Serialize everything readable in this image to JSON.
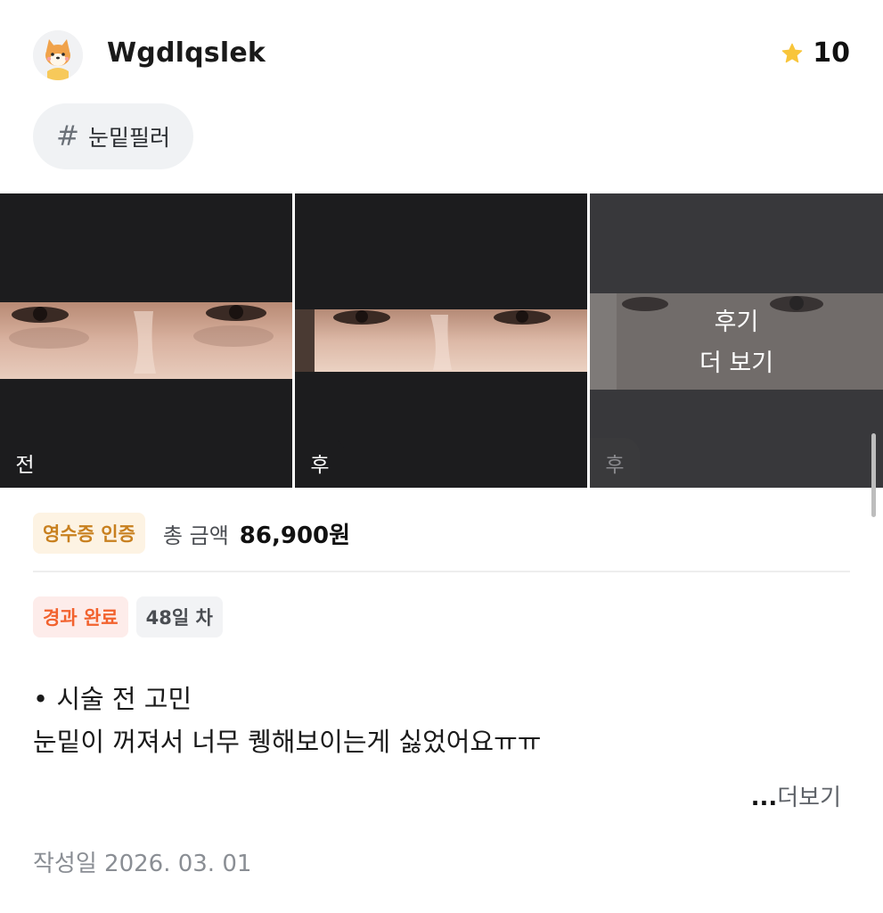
{
  "user": {
    "username": "Wgdlqslek",
    "avatar_icon": "shiba-dog-avatar-icon",
    "rating": "10"
  },
  "tag": {
    "hash": "#",
    "label": "눈밑필러"
  },
  "gallery": {
    "photos": [
      {
        "badge": "전"
      },
      {
        "badge": "후"
      },
      {
        "badge": "후"
      }
    ],
    "more_line1": "후기",
    "more_line2": "더 보기"
  },
  "price": {
    "receipt_label": "영수증 인증",
    "total_label": "총 금액",
    "total_value": "86,900원"
  },
  "status": {
    "progress_label": "경과 완료",
    "days_label": "48일 차"
  },
  "review": {
    "line1": "• 시술 전 고민",
    "line2": "눈밑이 꺼져서 너무 퀭해보이는게 싫었어요ㅠㅠ",
    "more_dots": "...",
    "more_label": "더보기"
  },
  "footer": {
    "written_date": "작성일 2026. 03. 01"
  },
  "colors": {
    "star": "#f8c53a",
    "receipt_text": "#c8801f",
    "done_text": "#f2622e"
  }
}
